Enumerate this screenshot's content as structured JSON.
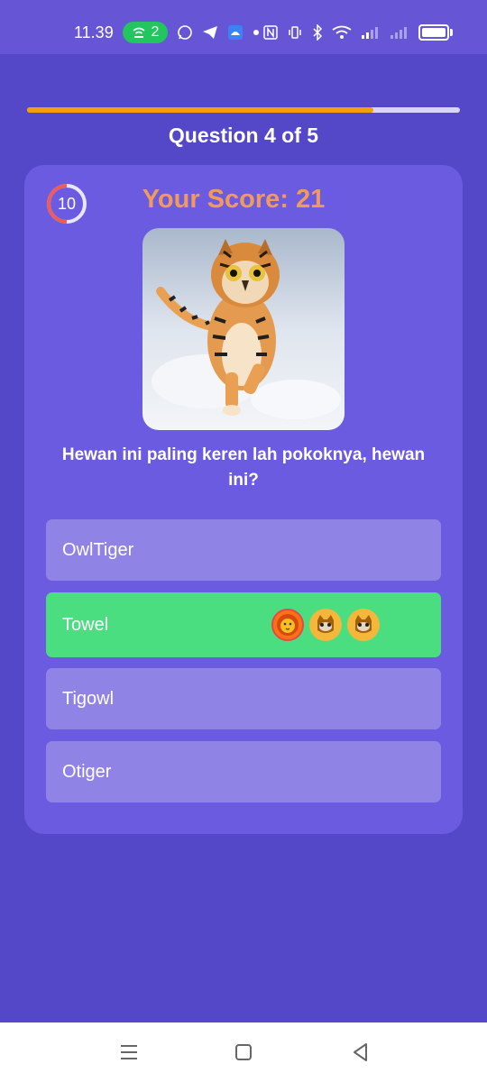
{
  "status_bar": {
    "time": "11.39",
    "hotspot_count": "2"
  },
  "quiz": {
    "progress_fraction": 0.8,
    "question_counter": "Question 4 of 5",
    "timer": "10",
    "score": "Your Score: 21",
    "question": "Hewan ini paling keren lah pokoknya, hewan ini?",
    "options": [
      {
        "label": "OwlTiger",
        "state": "default"
      },
      {
        "label": "Towel",
        "state": "correct",
        "avatars": [
          "lion-avatar-icon",
          "cat-avatar-icon",
          "cat-avatar-icon"
        ]
      },
      {
        "label": "Tigowl",
        "state": "default"
      },
      {
        "label": "Otiger",
        "state": "default"
      }
    ]
  },
  "colors": {
    "background": "#5548c8",
    "card": "#6b5be0",
    "option": "#8f84e6",
    "correct": "#4ade80",
    "progress": "#f59e0b",
    "score": "#f29a5c"
  }
}
